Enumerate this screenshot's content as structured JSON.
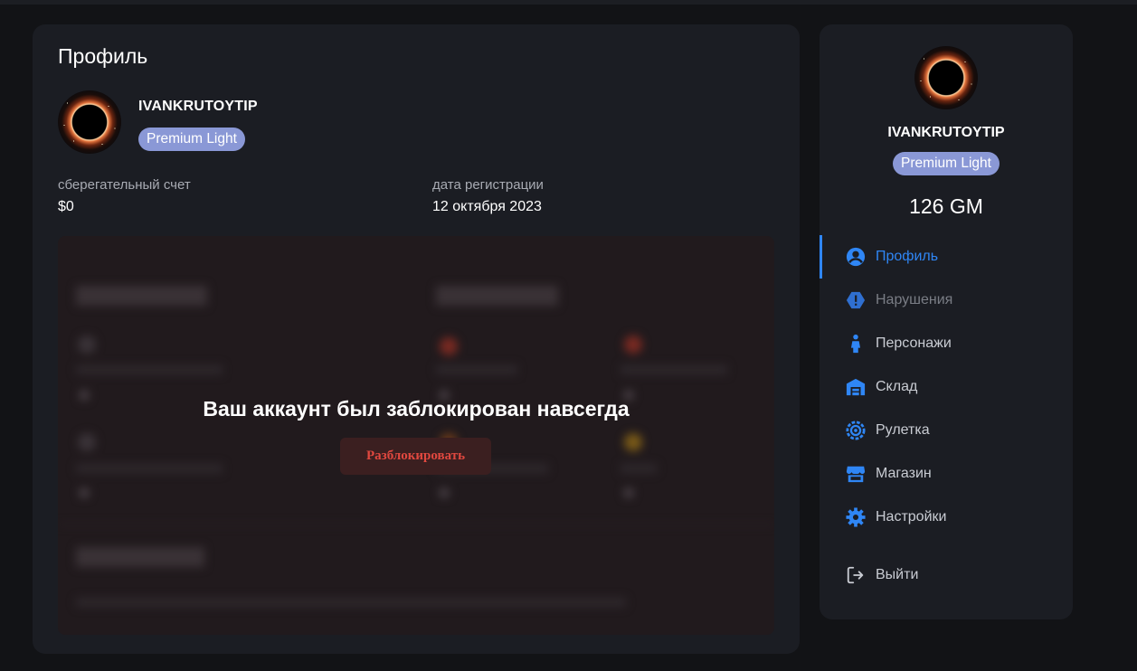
{
  "profile": {
    "title": "Профиль",
    "username": "IVANKRUTOYTIP",
    "badge": "Premium Light",
    "savings_label": "сберегательный счет",
    "savings_value": "$0",
    "reg_label": "дата регистрации",
    "reg_value": "12 октября 2023",
    "blocked_message": "Ваш аккаунт был заблокирован навсегда",
    "unlock_label": "Разблокировать"
  },
  "sidebar": {
    "username": "IVANKRUTOYTIP",
    "badge": "Premium Light",
    "balance": "126 GM",
    "items": [
      {
        "label": "Профиль",
        "icon": "user-circle-icon",
        "state": "active"
      },
      {
        "label": "Нарушения",
        "icon": "warning-hexagon-icon",
        "state": "muted"
      },
      {
        "label": "Персонажи",
        "icon": "person-icon",
        "state": "normal"
      },
      {
        "label": "Склад",
        "icon": "warehouse-icon",
        "state": "normal"
      },
      {
        "label": "Рулетка",
        "icon": "roulette-icon",
        "state": "normal"
      },
      {
        "label": "Магазин",
        "icon": "shop-icon",
        "state": "normal"
      },
      {
        "label": "Настройки",
        "icon": "gear-icon",
        "state": "normal"
      }
    ],
    "logout_label": "Выйти"
  },
  "colors": {
    "accent": "#2f86f5",
    "badge": "#8a98d6",
    "danger": "#e0483f"
  }
}
